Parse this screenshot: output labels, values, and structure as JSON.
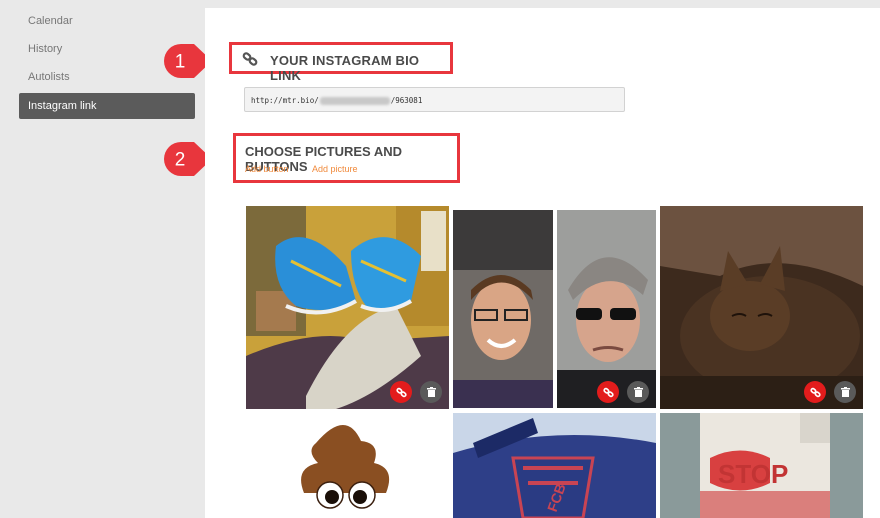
{
  "sidebar": {
    "items": [
      {
        "label": "Calendar",
        "active": false
      },
      {
        "label": "History",
        "active": false
      },
      {
        "label": "Autolists",
        "active": false
      },
      {
        "label": "Instagram link",
        "active": true
      }
    ]
  },
  "callouts": [
    "1",
    "2"
  ],
  "bio_link": {
    "title": "YOUR INSTAGRAM BIO LINK",
    "url_prefix": "http://mtr.bio/",
    "url_suffix": "/963081"
  },
  "choose": {
    "title": "CHOOSE PICTURES AND BUTTONS",
    "add_button": "Add button",
    "add_picture": "Add picture"
  },
  "icons": {
    "link": "link-icon",
    "trash": "trash-icon"
  },
  "colors": {
    "accent_red": "#e8363d",
    "link_orange": "#f08a3c",
    "active_nav": "#5b5b5b"
  }
}
